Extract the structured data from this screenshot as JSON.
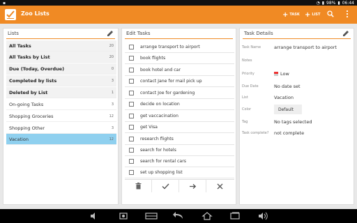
{
  "status": {
    "battery": "98%",
    "time": "06:44"
  },
  "app": {
    "title": "Zoo Lists",
    "add_task_label": "TASK",
    "add_list_label": "LIST",
    "accent": "#f08a24"
  },
  "lists_panel": {
    "header": "Lists",
    "items": [
      {
        "label": "All Tasks",
        "count": "20",
        "bold": true
      },
      {
        "label": "All Tasks by List",
        "count": "20",
        "bold": true
      },
      {
        "label": "Due (Today, Overdue)",
        "count": "0",
        "bold": true
      },
      {
        "label": "Completed by lists",
        "count": "3",
        "bold": true
      },
      {
        "label": "Deleted by List",
        "count": "1",
        "bold": true
      },
      {
        "label": "On-going Tasks",
        "count": "3",
        "bold": false
      },
      {
        "label": "Shopping Groceries",
        "count": "12",
        "bold": false
      },
      {
        "label": "Shopping Other",
        "count": "3",
        "bold": false
      },
      {
        "label": "Vacation",
        "count": "12",
        "bold": false,
        "selected": true
      }
    ]
  },
  "edit_panel": {
    "header": "Edit Tasks",
    "tasks": [
      "arrange transport to airport",
      "book flights",
      "book hotel and car",
      "contact Jane for mail pick up",
      "contact Joe for gardening",
      "decide on location",
      "get vaccacination",
      "get Visa",
      "research flights",
      "search for hotels",
      "search for rental cars",
      "set up shopping list"
    ]
  },
  "details_panel": {
    "header": "Task Details",
    "fields": {
      "task_name": {
        "key": "Task Name",
        "value": "arrange transport to airport"
      },
      "notes": {
        "key": "Notes",
        "value": ""
      },
      "priority": {
        "key": "Priority",
        "value": "Low"
      },
      "due_date": {
        "key": "Due Date",
        "value": "No date set"
      },
      "list": {
        "key": "List",
        "value": "Vacation"
      },
      "color": {
        "key": "Color",
        "value": "Default"
      },
      "tag": {
        "key": "Tag",
        "value": "No tags selected"
      },
      "complete": {
        "key": "Task complete?",
        "value": "not complete"
      }
    }
  }
}
